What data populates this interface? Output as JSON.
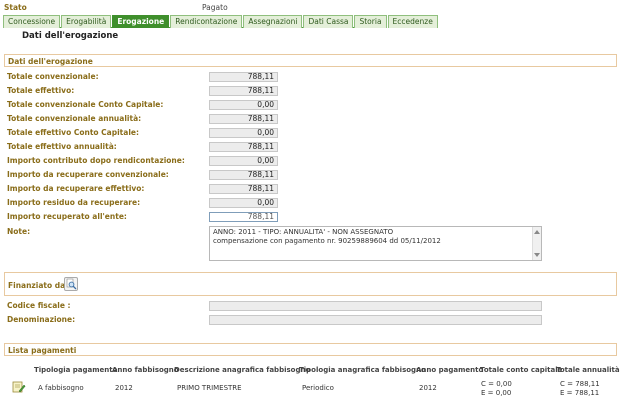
{
  "header": {
    "stato_label": "Stato",
    "stato_value": "Pagato"
  },
  "tabs": [
    {
      "label": "Concessione",
      "active": false
    },
    {
      "label": "Erogabilità",
      "active": false
    },
    {
      "label": "Erogazione",
      "active": true
    },
    {
      "label": "Rendicontazione",
      "active": false
    },
    {
      "label": "Assegnazioni",
      "active": false
    },
    {
      "label": "Dati Cassa",
      "active": false
    },
    {
      "label": "Storia",
      "active": false
    },
    {
      "label": "Eccedenze",
      "active": false
    }
  ],
  "page_title": "Dati dell'erogazione",
  "section_erogazione": {
    "title": "Dati dell'erogazione",
    "fields": [
      {
        "label": "Totale convenzionale:",
        "value": "788,11"
      },
      {
        "label": "Totale effettivo:",
        "value": "788,11"
      },
      {
        "label": "Totale convenzionale Conto Capitale:",
        "value": "0,00"
      },
      {
        "label": "Totale convenzionale annualità:",
        "value": "788,11"
      },
      {
        "label": "Totale effettivo Conto Capitale:",
        "value": "0,00"
      },
      {
        "label": "Totale effettivo annualità:",
        "value": "788,11"
      },
      {
        "label": "Importo contributo dopo rendicontazione:",
        "value": "0,00"
      },
      {
        "label": "Importo da recuperare convenzionale:",
        "value": "788,11"
      },
      {
        "label": "Importo da recuperare effettivo:",
        "value": "788,11"
      },
      {
        "label": "Importo residuo da recuperare:",
        "value": "0,00"
      },
      {
        "label": "Importo recuperato all'ente:",
        "value": "788,11"
      }
    ],
    "note_label": "Note:",
    "note_lines": [
      "ANNO: 2011 - TIPO: ANNUALITA' - NON ASSEGNATO",
      "compensazione con pagamento nr. 90259889604 dd 05/11/2012"
    ]
  },
  "section_finanziato": {
    "title": "Finanziato da",
    "codice_fiscale_label": "Codice fiscale :",
    "codice_fiscale_value": "",
    "denominazione_label": "Denominazione:",
    "denominazione_value": ""
  },
  "section_pagamenti": {
    "title": "Lista pagamenti",
    "columns": [
      "Tipologia pagamento",
      "Anno fabbisogno",
      "Descrizione anagrafica fabbisogno",
      "Tipologia anagrafica fabbisogno",
      "Anno pagamento",
      "Totale conto capitale",
      "Totale annualità"
    ],
    "rows": [
      {
        "tipologia_pagamento": "A fabbisogno",
        "anno_fabbisogno": "2012",
        "descrizione": "PRIMO TRIMESTRE",
        "tipologia_anagrafica": "Periodico",
        "anno_pagamento": "2012",
        "conto_capitale_c": "C = 0,00",
        "conto_capitale_e": "E = 0,00",
        "annualita_c": "C = 788,11",
        "annualita_e": "E = 788,11"
      }
    ]
  },
  "icons": {
    "search": "magnifier-icon",
    "row_action": "document-edit-icon"
  }
}
